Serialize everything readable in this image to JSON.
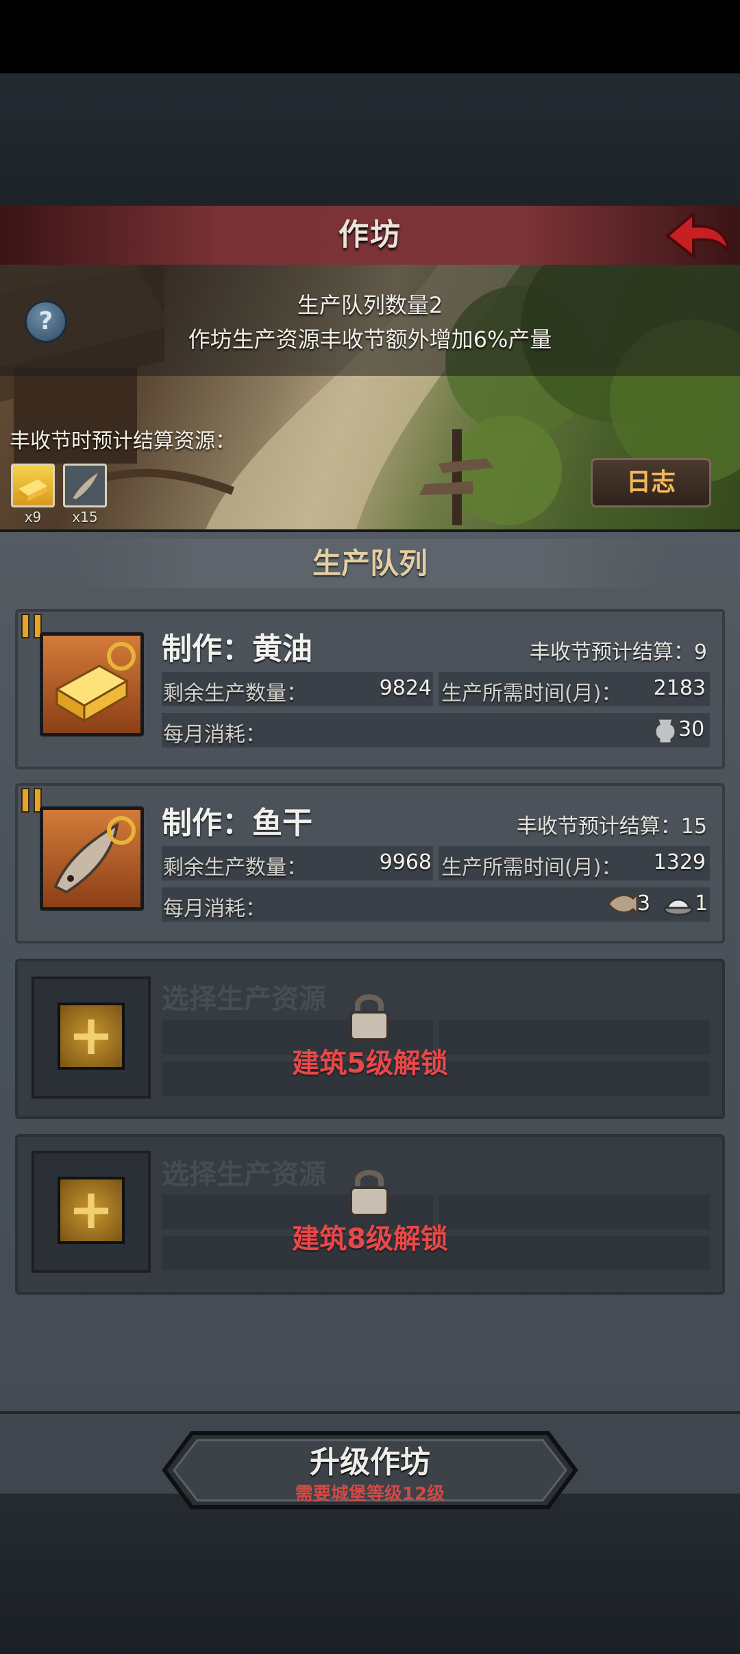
{
  "header": {
    "title": "作坊"
  },
  "banner": {
    "info_line1": "生产队列数量2",
    "info_line2": "作坊生产资源丰收节额外增加6%产量",
    "forecast_label": "丰收节时预计结算资源：",
    "resources": [
      {
        "icon": "butter-icon",
        "count": "x9"
      },
      {
        "icon": "dried-fish-icon",
        "count": "x15"
      }
    ],
    "log_button": "日志"
  },
  "queue": {
    "title": "生产队列",
    "items": [
      {
        "title": "制作：黄油",
        "forecast": "丰收节预计结算：9",
        "remaining_label": "剩余生产数量：",
        "remaining_value": "9824",
        "time_label": "生产所需时间(月)：",
        "time_value": "2183",
        "consume_label": "每月消耗：",
        "consumption": [
          {
            "icon": "milk-jug-icon",
            "value": "30"
          }
        ]
      },
      {
        "title": "制作：鱼干",
        "forecast": "丰收节预计结算：15",
        "remaining_label": "剩余生产数量：",
        "remaining_value": "9968",
        "time_label": "生产所需时间(月)：",
        "time_value": "1329",
        "consume_label": "每月消耗：",
        "consumption": [
          {
            "icon": "fish-icon",
            "value": "3"
          },
          {
            "icon": "salt-icon",
            "value": "1"
          }
        ]
      }
    ],
    "locked_slots": [
      {
        "title": "选择生产资源",
        "unlock_text": "建筑5级解锁"
      },
      {
        "title": "选择生产资源",
        "unlock_text": "建筑8级解锁"
      }
    ]
  },
  "upgrade": {
    "label": "升级作坊",
    "requirement": "需要城堡等级12级"
  },
  "colors": {
    "title_bar": "#7a3236",
    "accent_gold": "#e2cfa3",
    "lock_red": "#e8484a",
    "log_text": "#f3b65a"
  }
}
